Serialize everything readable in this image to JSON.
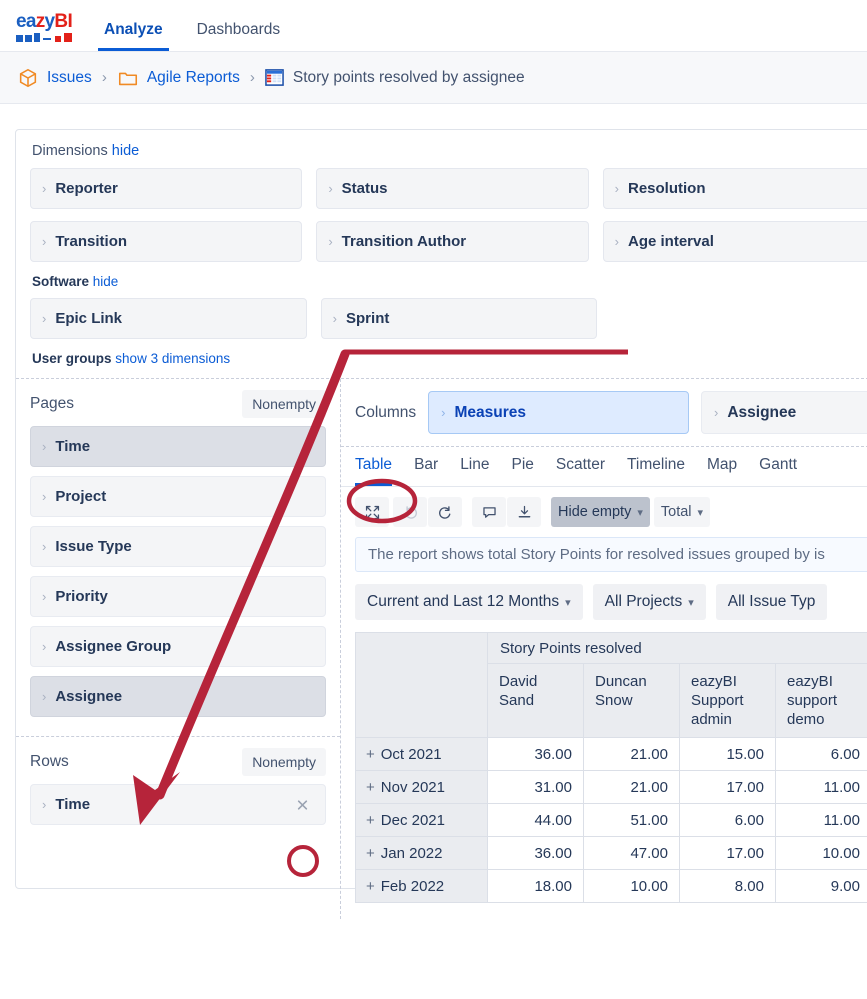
{
  "brand": {
    "logo_text_parts": [
      "ea",
      "z",
      "y",
      "BI"
    ],
    "accent_blue": "#0b5cd5",
    "accent_red": "#e32119",
    "annotation_red": "#b6243a"
  },
  "topnav": {
    "tabs": [
      {
        "label": "Analyze",
        "active": true
      },
      {
        "label": "Dashboards",
        "active": false
      }
    ]
  },
  "breadcrumb": {
    "items": [
      {
        "label": "Issues",
        "icon": "cube-icon",
        "type": "link"
      },
      {
        "label": "Agile Reports",
        "icon": "folder-icon",
        "type": "link"
      },
      {
        "label": "Story points resolved by assignee",
        "icon": "table-report-icon",
        "type": "current"
      }
    ],
    "separator": "›"
  },
  "dimensions": {
    "title": "Dimensions",
    "hide_label": "hide",
    "rows": [
      [
        "Reporter",
        "Status",
        "Resolution"
      ],
      [
        "Transition",
        "Transition Author",
        "Age interval"
      ]
    ],
    "software": {
      "title": "Software",
      "hide_label": "hide",
      "items": [
        "Epic Link",
        "Sprint"
      ]
    },
    "user_groups": {
      "title": "User groups",
      "show_link": "show 3 dimensions"
    }
  },
  "pages": {
    "title": "Pages",
    "nonempty_label": "Nonempty",
    "items": [
      {
        "label": "Time",
        "selected": true
      },
      {
        "label": "Project",
        "selected": false
      },
      {
        "label": "Issue Type",
        "selected": false
      },
      {
        "label": "Priority",
        "selected": false
      },
      {
        "label": "Assignee Group",
        "selected": false
      },
      {
        "label": "Assignee",
        "selected": true
      }
    ]
  },
  "rows_panel": {
    "title": "Rows",
    "nonempty_label": "Nonempty",
    "items": [
      {
        "label": "Time",
        "has_remove": true,
        "remove_icon": "close-circle-icon"
      }
    ]
  },
  "columns_panel": {
    "title": "Columns",
    "chips": [
      {
        "label": "Measures",
        "highlighted": true
      },
      {
        "label": "Assignee",
        "highlighted": false
      }
    ]
  },
  "viz_tabs": [
    {
      "label": "Table",
      "active": true
    },
    {
      "label": "Bar",
      "active": false
    },
    {
      "label": "Line",
      "active": false
    },
    {
      "label": "Pie",
      "active": false
    },
    {
      "label": "Scatter",
      "active": false
    },
    {
      "label": "Timeline",
      "active": false
    },
    {
      "label": "Map",
      "active": false
    },
    {
      "label": "Gantt",
      "active": false
    }
  ],
  "toolbar": {
    "buttons": [
      {
        "name": "fullscreen-icon",
        "glyph": "⤢",
        "state": "normal"
      },
      {
        "name": "undo-icon",
        "glyph": "↺",
        "state": "disabled"
      },
      {
        "name": "redo-icon",
        "glyph": "↻",
        "state": "normal"
      },
      {
        "name": "comment-icon",
        "glyph": "὞9",
        "state": "normal"
      },
      {
        "name": "download-icon",
        "glyph": "⤓",
        "state": "normal"
      }
    ],
    "hide_empty_label": "Hide empty",
    "total_label": "Total"
  },
  "description": "The report shows total Story Points for resolved issues grouped by is",
  "filters": [
    {
      "label": "Current and Last 12 Months"
    },
    {
      "label": "All Projects"
    },
    {
      "label": "All Issue Typ"
    }
  ],
  "chart_data": {
    "type": "table",
    "title": "Story Points resolved",
    "row_header_label": "",
    "categories": [
      "Oct 2021",
      "Nov 2021",
      "Dec 2021",
      "Jan 2022",
      "Feb 2022"
    ],
    "columns": [
      "David Sand",
      "Duncan Snow",
      "eazyBI Support admin",
      "eazyBI support demo"
    ],
    "series": [
      {
        "name": "David Sand",
        "values": [
          "36.00",
          "31.00",
          "44.00",
          "36.00",
          "18.00"
        ]
      },
      {
        "name": "Duncan Snow",
        "values": [
          "21.00",
          "21.00",
          "51.00",
          "47.00",
          "10.00"
        ]
      },
      {
        "name": "eazyBI Support admin",
        "values": [
          "15.00",
          "17.00",
          "6.00",
          "17.00",
          "8.00"
        ]
      },
      {
        "name": "eazyBI support demo",
        "values": [
          "6.00",
          "11.00",
          "11.00",
          "10.00",
          "9.00"
        ]
      }
    ],
    "row_expand_glyph": "+"
  }
}
